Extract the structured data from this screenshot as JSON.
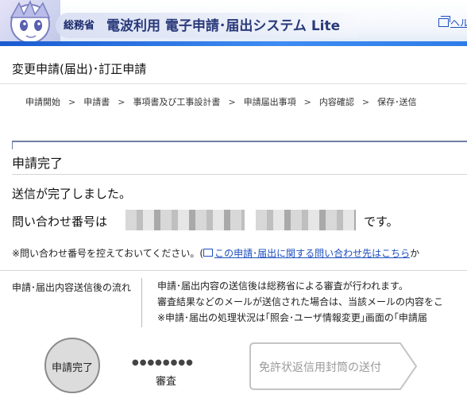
{
  "header": {
    "ministry": "総務省",
    "system_title": "電波利用 電子申請･届出システム Lite",
    "help_label": "ヘル"
  },
  "page": {
    "title": "変更申請(届出)･訂正申請"
  },
  "breadcrumb": {
    "items": [
      "申請開始",
      "申請書",
      "事項書及び工事設計書",
      "申請届出事項",
      "内容確認",
      "保存･送信"
    ],
    "separator": ">"
  },
  "completion": {
    "heading": "申請完了",
    "message": "送信が完了しました。",
    "inquiry_prefix": "問い合わせ番号は",
    "inquiry_suffix": "です。",
    "note_prefix": "※問い合わせ番号を控えておいてください。(",
    "note_link": "この申請･届出に関する問い合わせ先はこちら",
    "note_tail": "か"
  },
  "flow_info": {
    "label": "申請･届出内容送信後の流れ",
    "lines": [
      "申請･届出内容の送信後は総務省による審査が行われます。",
      "審査結果などのメールが送信された場合は、当該メールの内容をこ",
      "※申請･届出の処理状況は｢照会･ユーザ情報変更｣画面の｢申請届"
    ]
  },
  "flow_steps": {
    "current": "申請完了",
    "dots": "●●●●●●●●",
    "review": "審査",
    "next": "免許状返信用封筒の送付"
  },
  "colors": {
    "brand_blue": "#1a5bd0",
    "link_blue": "#1d4fbf",
    "title_navy": "#2a3a7a"
  }
}
